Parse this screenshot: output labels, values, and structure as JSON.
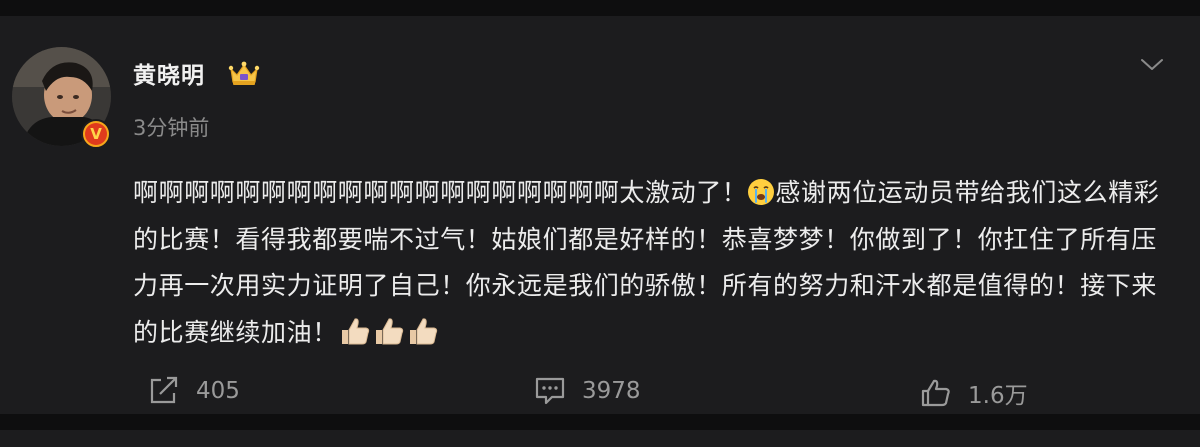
{
  "post": {
    "author": "黄晓明",
    "time": "3分钟前",
    "verified_mark": "V",
    "text_part1": "啊啊啊啊啊啊啊啊啊啊啊啊啊啊啊啊啊啊啊太激动了！",
    "text_part2": "感谢两位运动员带给我们这么精彩的比赛！看得我都要喘不过气！姑娘们都是好样的！恭喜梦梦！你做到了！你扛住了所有压力再一次用实力证明了自己！你永远是我们的骄傲！所有的努力和汗水都是值得的！接下来的比赛继续加油！",
    "emojis": [
      "crying-face-emoji",
      "thumbs-up-emoji",
      "thumbs-up-emoji",
      "thumbs-up-emoji"
    ]
  },
  "actions": {
    "repost": {
      "icon": "repost-icon",
      "count": "405"
    },
    "comment": {
      "icon": "comment-icon",
      "count": "3978"
    },
    "like": {
      "icon": "thumbs-up-icon",
      "count": "1.6万"
    }
  },
  "icons": {
    "menu": "chevron-down-icon",
    "member_badge": "crown-icon"
  },
  "colors": {
    "background": "#0e0e0f",
    "card": "#1c1c1e",
    "text": "#ececec",
    "muted": "#8a8a8a",
    "verify": "#f6a71b"
  }
}
